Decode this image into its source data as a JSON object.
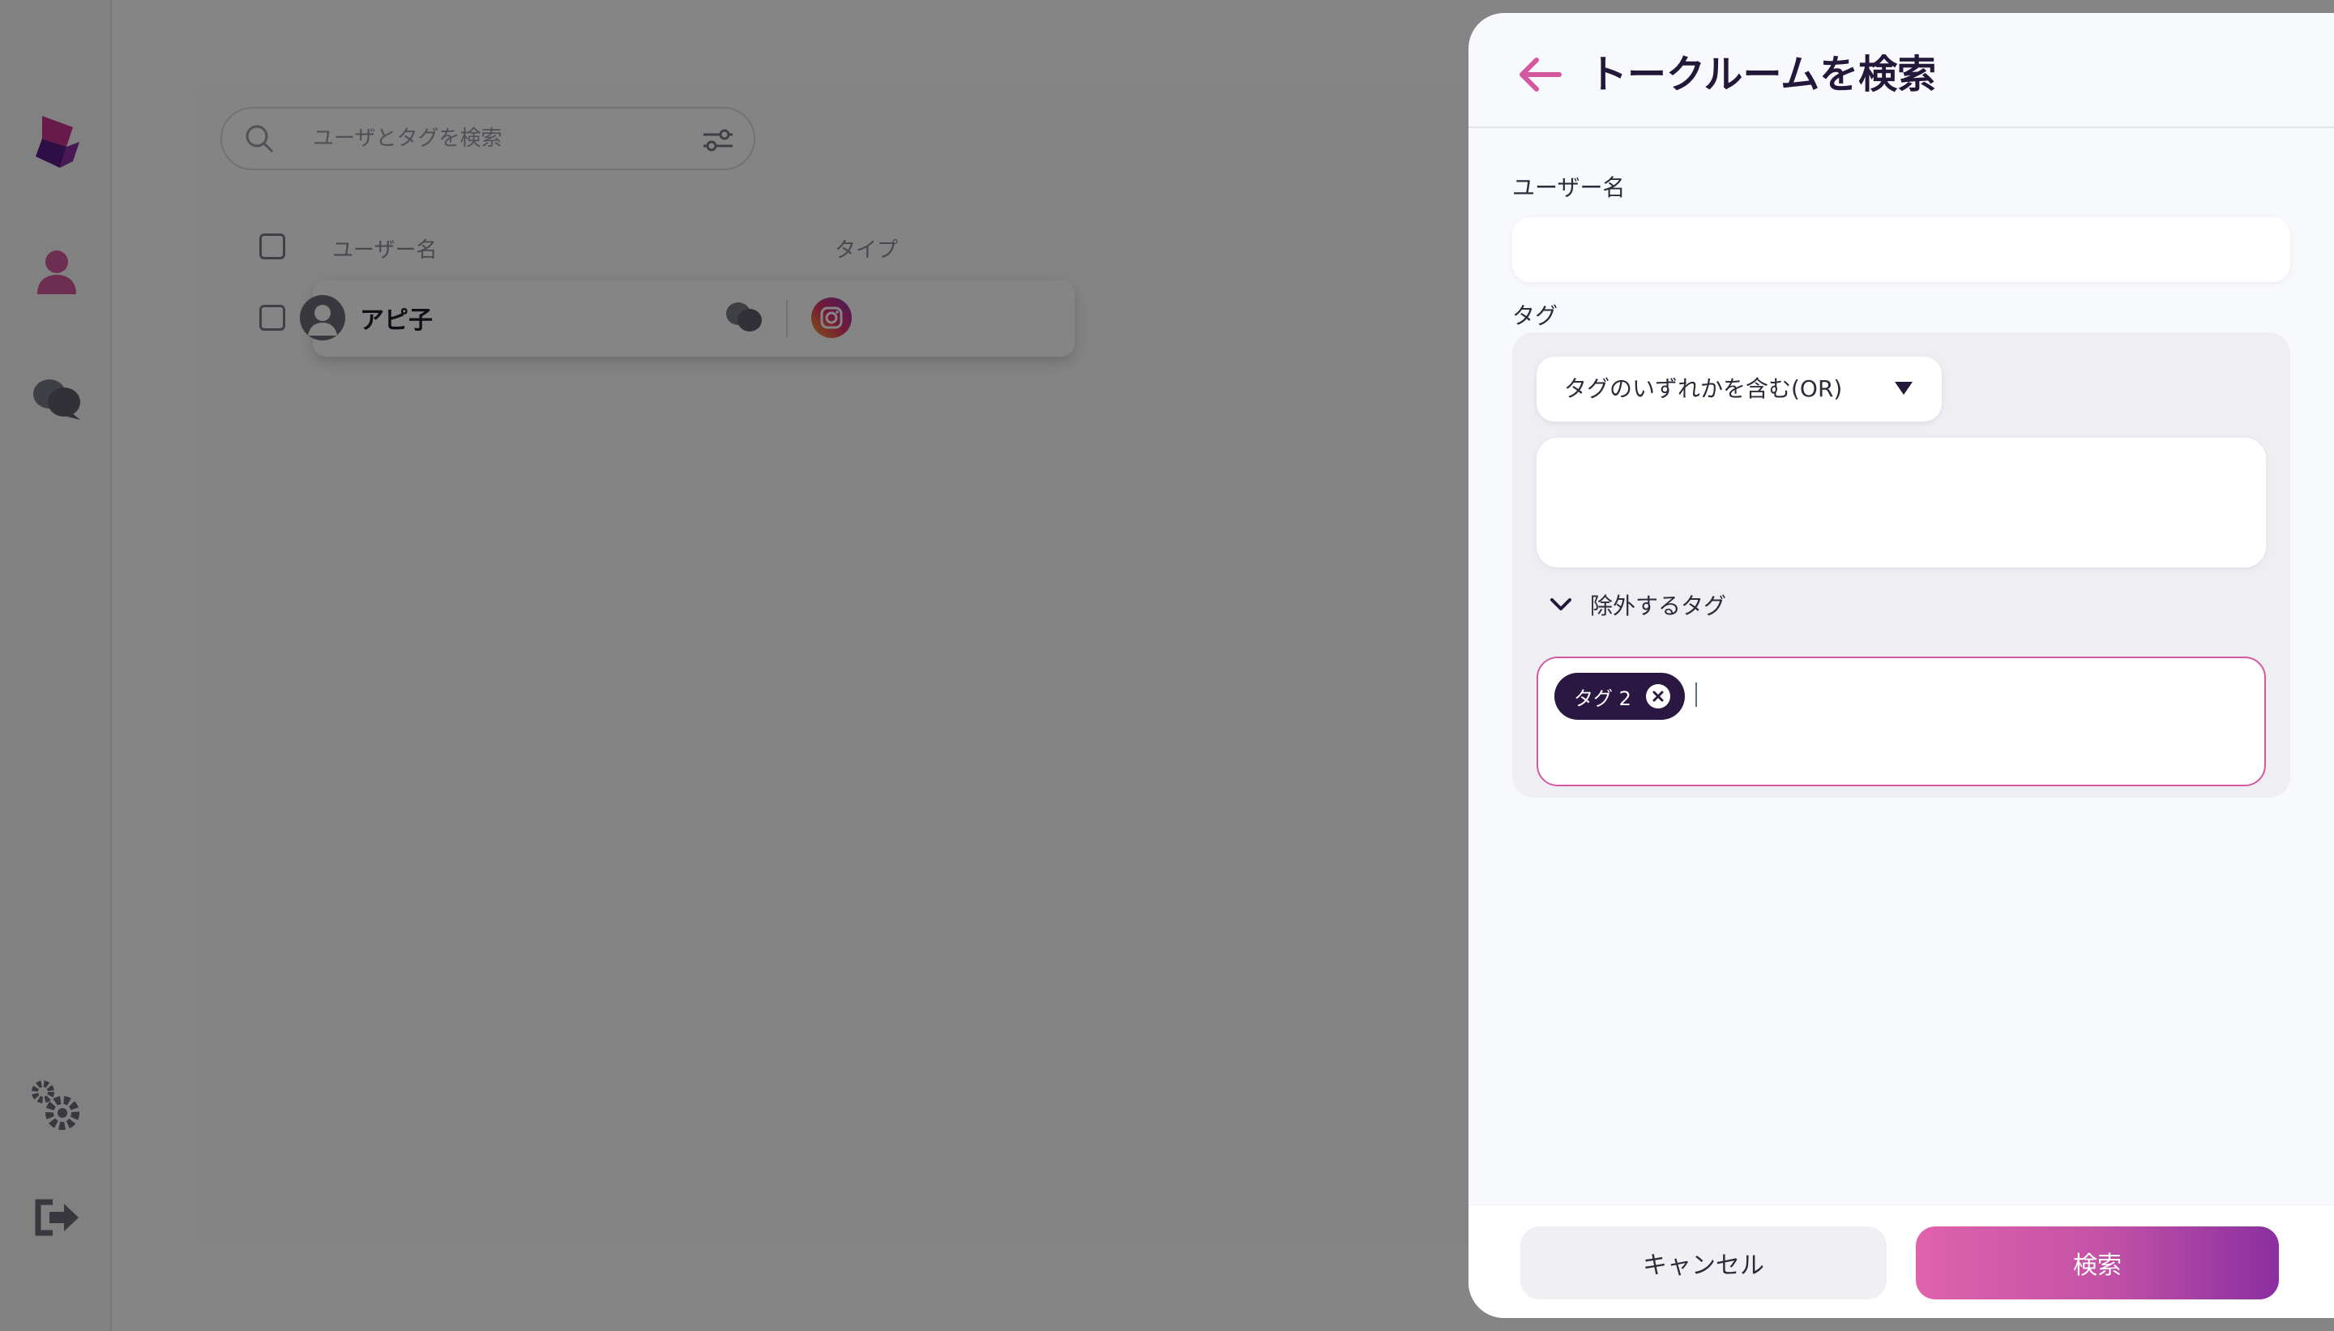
{
  "background": {
    "search": {
      "placeholder": "ユーザとタグを検索"
    },
    "table": {
      "headers": {
        "username": "ユーザー名",
        "type": "タイプ"
      },
      "rows": [
        {
          "name": "アピ子",
          "type_icon": "instagram-icon"
        }
      ]
    },
    "sidebar_icons": [
      "logo-icon",
      "user-icon",
      "chat-bubbles-icon",
      "settings-gears-icon",
      "logout-icon"
    ]
  },
  "panel": {
    "title": "トークルームを検索",
    "username": {
      "label": "ユーザー名",
      "value": ""
    },
    "tags": {
      "label": "タグ",
      "mode": {
        "selected": "タグのいずれかを含む(OR)"
      },
      "exclude": {
        "label": "除外するタグ",
        "chips": [
          {
            "label": "タグ 2"
          }
        ]
      }
    },
    "buttons": {
      "cancel": "キャンセル",
      "search": "検索"
    }
  },
  "colors": {
    "accent": "#d4589e",
    "chip": "#2a1842",
    "title": "#24183a"
  }
}
